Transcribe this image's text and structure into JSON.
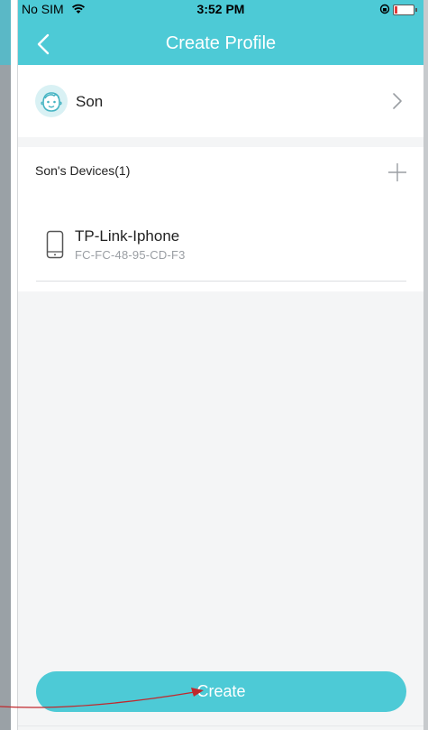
{
  "status_bar": {
    "carrier": "No SIM",
    "time": "3:52 PM"
  },
  "header": {
    "title": "Create Profile"
  },
  "profile": {
    "name": "Son"
  },
  "devices": {
    "header": "Son's Devices(1)",
    "items": [
      {
        "name": "TP-Link-Iphone",
        "mac": "FC-FC-48-95-CD-F3"
      }
    ]
  },
  "actions": {
    "create_label": "Create"
  },
  "colors": {
    "accent": "#4dcad6",
    "annotation_arrow": "#c0282d"
  }
}
